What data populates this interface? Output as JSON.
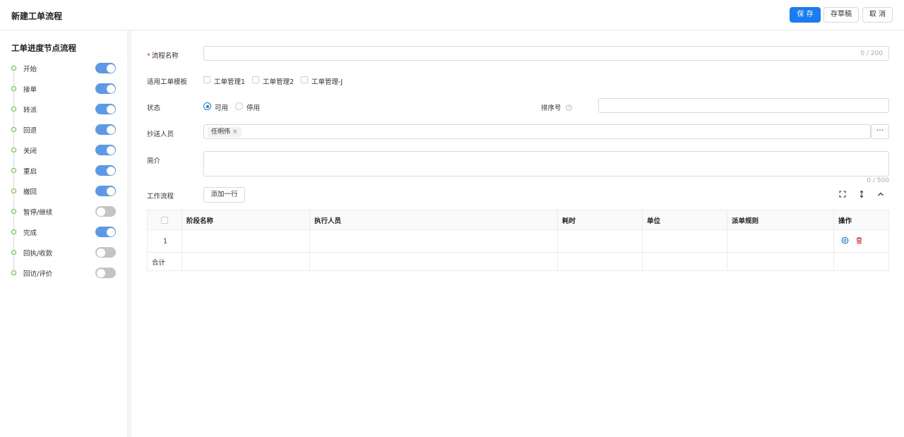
{
  "header": {
    "title": "新建工单流程",
    "save_label": "保 存",
    "draft_label": "存草稿",
    "cancel_label": "取 消"
  },
  "sidebar": {
    "title": "工单进度节点流程",
    "nodes": [
      {
        "label": "开始",
        "enabled": true
      },
      {
        "label": "接单",
        "enabled": true
      },
      {
        "label": "转派",
        "enabled": true
      },
      {
        "label": "回退",
        "enabled": true
      },
      {
        "label": "关闭",
        "enabled": true
      },
      {
        "label": "重启",
        "enabled": true
      },
      {
        "label": "撤回",
        "enabled": true
      },
      {
        "label": "暂停/继续",
        "enabled": false
      },
      {
        "label": "完成",
        "enabled": true
      },
      {
        "label": "回执/收款",
        "enabled": false
      },
      {
        "label": "回访/评价",
        "enabled": false
      }
    ]
  },
  "form": {
    "name_label": "流程名称",
    "name_required_mark": "*",
    "name_value": "",
    "name_counter": "0 / 200",
    "template_label": "适用工单模板",
    "templates": [
      {
        "label": "工单管理1",
        "checked": false
      },
      {
        "label": "工单管理2",
        "checked": false
      },
      {
        "label": "工单管理-J",
        "checked": false
      }
    ],
    "status_label": "状态",
    "status_options": [
      {
        "label": "可用",
        "checked": true
      },
      {
        "label": "停用",
        "checked": false
      }
    ],
    "sort_label": "排序号",
    "sort_help_icon": "question-circle-icon",
    "sort_value": "",
    "cc_label": "抄送人员",
    "cc_tags": [
      "任明伟"
    ],
    "cc_tag_remove": "×",
    "cc_more": "···",
    "intro_label": "简介",
    "intro_value": "",
    "intro_counter": "0 / 500",
    "workflow_label": "工作流程",
    "add_row_label": "添加一行"
  },
  "table": {
    "columns": [
      "阶段名称",
      "执行人员",
      "耗时",
      "单位",
      "派单规则",
      "操作"
    ],
    "rows": [
      {
        "index": "1",
        "stage": "",
        "executor": "",
        "duration": "",
        "unit": "",
        "rule": ""
      }
    ],
    "total_label": "合计"
  },
  "colors": {
    "primary": "#1a7cf5",
    "toggle_on": "#5b9ae9",
    "toggle_off": "#c4c4c4",
    "node_dot": "#52c41a",
    "required": "#f5222d",
    "delete_icon": "#f5222d",
    "settings_icon": "#1a7cf5"
  }
}
